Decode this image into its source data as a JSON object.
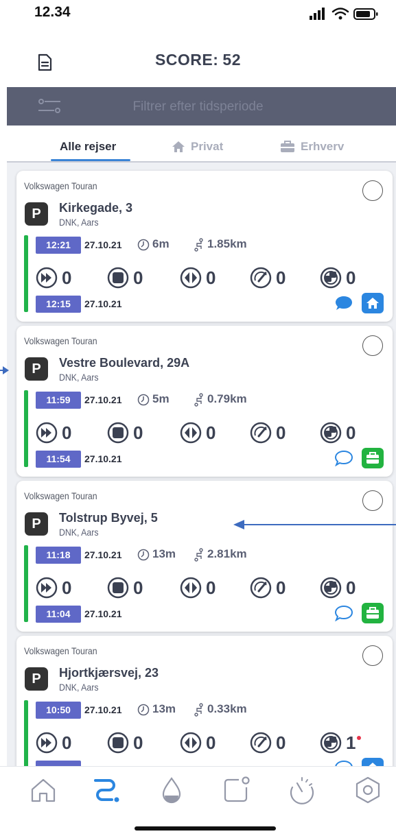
{
  "status_bar": {
    "time": "12.34"
  },
  "header": {
    "score_label": "SCORE:",
    "score_value": "52"
  },
  "filter": {
    "placeholder": "Filtrer efter tidsperiode"
  },
  "tabs": [
    {
      "label": "Alle rejser",
      "active": true
    },
    {
      "label": "Privat",
      "active": false
    },
    {
      "label": "Erhverv",
      "active": false
    }
  ],
  "trips": [
    {
      "vehicle": "Volkswagen Touran",
      "address": "Kirkegade, 3",
      "city": "DNK, Aars",
      "end_time": "12:21",
      "end_date": "27.10.21",
      "duration": "6m",
      "distance": "1.85km",
      "metrics": [
        "0",
        "0",
        "0",
        "0",
        "0"
      ],
      "start_time": "12:15",
      "start_date": "27.10.21",
      "type": "home",
      "comment": "filled"
    },
    {
      "vehicle": "Volkswagen Touran",
      "address": "Vestre Boulevard, 29A",
      "city": "DNK, Aars",
      "end_time": "11:59",
      "end_date": "27.10.21",
      "duration": "5m",
      "distance": "0.79km",
      "metrics": [
        "0",
        "0",
        "0",
        "0",
        "0"
      ],
      "start_time": "11:54",
      "start_date": "27.10.21",
      "type": "work",
      "comment": "outline"
    },
    {
      "vehicle": "Volkswagen Touran",
      "address": "Tolstrup Byvej, 5",
      "city": "DNK, Aars",
      "end_time": "11:18",
      "end_date": "27.10.21",
      "duration": "13m",
      "distance": "2.81km",
      "metrics": [
        "0",
        "0",
        "0",
        "0",
        "0"
      ],
      "start_time": "11:04",
      "start_date": "27.10.21",
      "type": "work",
      "comment": "outline"
    },
    {
      "vehicle": "Volkswagen Touran",
      "address": "Hjortkjærsvej, 23",
      "city": "DNK, Aars",
      "end_time": "10:50",
      "end_date": "27.10.21",
      "duration": "13m",
      "distance": "0.33km",
      "metrics": [
        "0",
        "0",
        "0",
        "0",
        "1"
      ],
      "start_time": "",
      "start_date": "",
      "type": "home",
      "comment": "outline"
    }
  ],
  "parking_badge": "P",
  "colors": {
    "accent": "#5f68c7",
    "green": "#21b34a",
    "blue": "#2b86e0",
    "filter_bar": "#5a5f73"
  },
  "nav": [
    "home-icon",
    "trips-icon",
    "fuel-icon",
    "notification-icon",
    "speedometer-icon",
    "settings-icon"
  ]
}
